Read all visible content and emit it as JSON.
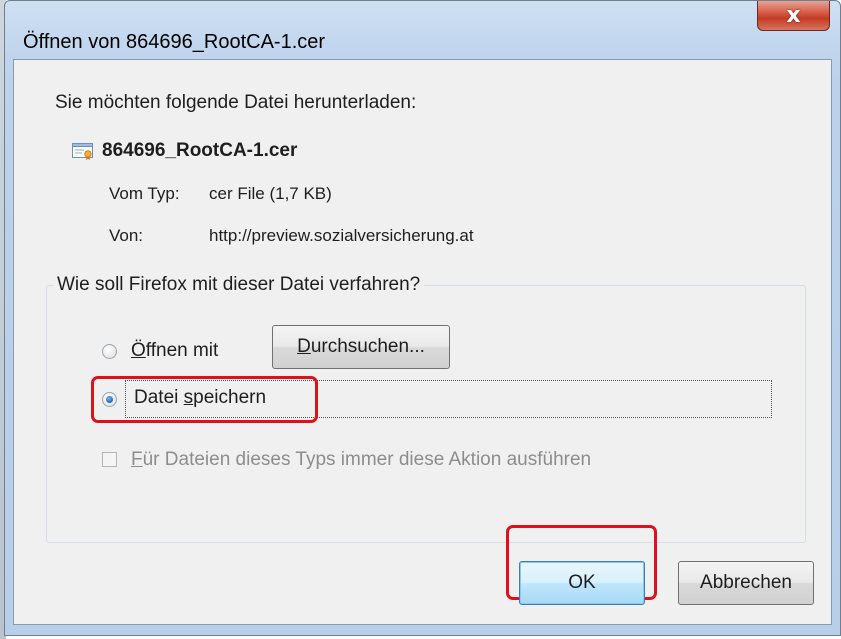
{
  "window": {
    "title": "Öffnen von 864696_RootCA-1.cer",
    "close_glyph": "x"
  },
  "intro_text": "Sie möchten folgende Datei herunterladen:",
  "file": {
    "icon": "certificate-icon",
    "name": "864696_RootCA-1.cer",
    "type_label": "Vom Typ:",
    "type_value": "cer File (1,7 KB)",
    "from_label": "Von:",
    "from_value": "http://preview.sozialversicherung.at"
  },
  "action_group": {
    "legend": "Wie soll Firefox mit dieser Datei verfahren?",
    "open_with": {
      "label_first": "Ö",
      "label_rest": "ffnen mit",
      "selected": false
    },
    "browse_button": {
      "label_first": "D",
      "label_rest": "urchsuchen..."
    },
    "save_file": {
      "label_start": "Datei ",
      "label_access": "s",
      "label_end": "peichern",
      "selected": true
    },
    "always_checkbox": {
      "label_first": "F",
      "label_rest": "ür Dateien dieses Typs immer diese Aktion ausführen",
      "checked": false,
      "enabled": false
    }
  },
  "buttons": {
    "ok": "OK",
    "cancel": "Abbrechen"
  },
  "colors": {
    "highlight": "#e0101b",
    "dialog_bg": "#f0f0f0",
    "frame": "#bcd2eb",
    "close_button": "#c43b24"
  }
}
